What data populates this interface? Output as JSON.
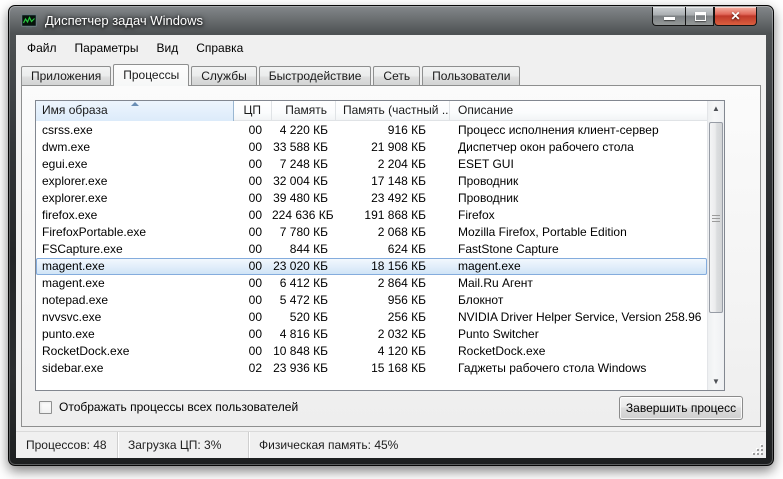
{
  "window": {
    "title": "Диспетчер задач Windows",
    "controls": {
      "minimize": "minimize",
      "maximize": "maximize",
      "close": "close"
    }
  },
  "menu_bar": {
    "items": [
      {
        "label": "Файл"
      },
      {
        "label": "Параметры"
      },
      {
        "label": "Вид"
      },
      {
        "label": "Справка"
      }
    ]
  },
  "tabs": {
    "active_index": 1,
    "items": [
      {
        "label": "Приложения"
      },
      {
        "label": "Процессы"
      },
      {
        "label": "Службы"
      },
      {
        "label": "Быстродействие"
      },
      {
        "label": "Сеть"
      },
      {
        "label": "Пользователи"
      }
    ]
  },
  "process_table": {
    "columns": [
      {
        "label": "Имя образа",
        "sorted": true,
        "sort_direction": "asc"
      },
      {
        "label": "ЦП"
      },
      {
        "label": "Память"
      },
      {
        "label": "Память (частный ..."
      },
      {
        "label": "Описание"
      }
    ],
    "rows": [
      {
        "name": "csrss.exe",
        "cpu": "00",
        "memory": "4 220 КБ",
        "memory_private": "916 КБ",
        "description": "Процесс исполнения клиент-сервер",
        "selected": false
      },
      {
        "name": "dwm.exe",
        "cpu": "00",
        "memory": "33 588 КБ",
        "memory_private": "21 908 КБ",
        "description": "Диспетчер окон рабочего стола",
        "selected": false
      },
      {
        "name": "egui.exe",
        "cpu": "00",
        "memory": "7 248 КБ",
        "memory_private": "2 204 КБ",
        "description": "ESET GUI",
        "selected": false
      },
      {
        "name": "explorer.exe",
        "cpu": "00",
        "memory": "32 004 КБ",
        "memory_private": "17 148 КБ",
        "description": "Проводник",
        "selected": false
      },
      {
        "name": "explorer.exe",
        "cpu": "00",
        "memory": "39 480 КБ",
        "memory_private": "23 492 КБ",
        "description": "Проводник",
        "selected": false
      },
      {
        "name": "firefox.exe",
        "cpu": "00",
        "memory": "224 636 КБ",
        "memory_private": "191 868 КБ",
        "description": "Firefox",
        "selected": false
      },
      {
        "name": "FirefoxPortable.exe",
        "cpu": "00",
        "memory": "7 780 КБ",
        "memory_private": "2 068 КБ",
        "description": "Mozilla Firefox, Portable Edition",
        "selected": false
      },
      {
        "name": "FSCapture.exe",
        "cpu": "00",
        "memory": "844 КБ",
        "memory_private": "624 КБ",
        "description": "FastStone Capture",
        "selected": false
      },
      {
        "name": "magent.exe",
        "cpu": "00",
        "memory": "23 020 КБ",
        "memory_private": "18 156 КБ",
        "description": "magent.exe",
        "selected": true
      },
      {
        "name": "magent.exe",
        "cpu": "00",
        "memory": "6 412 КБ",
        "memory_private": "2 864 КБ",
        "description": "Mail.Ru Агент",
        "selected": false
      },
      {
        "name": "notepad.exe",
        "cpu": "00",
        "memory": "5 472 КБ",
        "memory_private": "956 КБ",
        "description": "Блокнот",
        "selected": false
      },
      {
        "name": "nvvsvc.exe",
        "cpu": "00",
        "memory": "520 КБ",
        "memory_private": "256 КБ",
        "description": "NVIDIA Driver Helper Service, Version 258.96",
        "selected": false
      },
      {
        "name": "punto.exe",
        "cpu": "00",
        "memory": "4 816 КБ",
        "memory_private": "2 032 КБ",
        "description": "Punto Switcher",
        "selected": false
      },
      {
        "name": "RocketDock.exe",
        "cpu": "00",
        "memory": "10 848 КБ",
        "memory_private": "4 120 КБ",
        "description": "RocketDock.exe",
        "selected": false
      },
      {
        "name": "sidebar.exe",
        "cpu": "02",
        "memory": "23 936 КБ",
        "memory_private": "15 168 КБ",
        "description": "Гаджеты рабочего стола Windows",
        "selected": false
      }
    ]
  },
  "footer": {
    "show_all_users_label": "Отображать процессы всех пользователей",
    "show_all_users_checked": false,
    "end_process_button": "Завершить процесс"
  },
  "status_bar": {
    "processes": "Процессов: 48",
    "cpu_load": "Загрузка ЦП: 3%",
    "physical_memory": "Физическая память: 45%"
  },
  "colors": {
    "selection_border": "#84acdd",
    "selection_fill_bottom": "#cde3f6",
    "sorted_header_fill": "#dcebfa",
    "close_button_red": "#c0392a",
    "titlebar_dark": "#232527"
  }
}
